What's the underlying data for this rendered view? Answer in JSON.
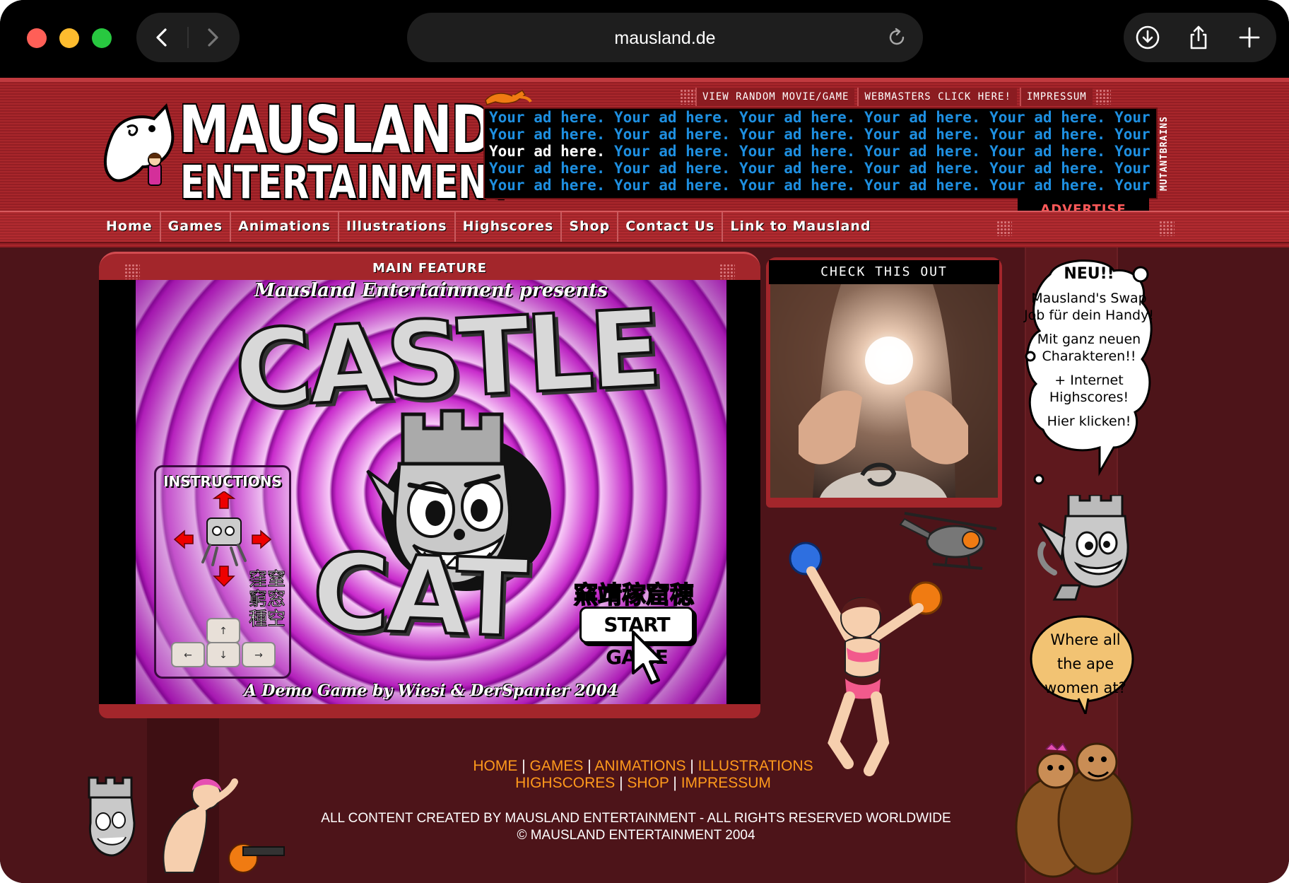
{
  "browser": {
    "url": "mausland.de"
  },
  "header": {
    "logo_line1": "MAUSLAND",
    "logo_line2": "ENTERTAINMENT",
    "top_links": [
      "VIEW RANDOM MOVIE/GAME",
      "WEBMASTERS CLICK HERE!",
      "IMPRESSUM"
    ],
    "ad_text": "Your ad here.",
    "advertise": "ADVERTISE HERE",
    "sidebar_vertical": "MUTANTBRAINS"
  },
  "nav": {
    "items": [
      "Home",
      "Games",
      "Animations",
      "Illustrations",
      "Highscores",
      "Shop",
      "Contact Us",
      "Link to Mausland"
    ]
  },
  "feature": {
    "title": "MAIN FEATURE",
    "presents": "Mausland Entertainment presents",
    "game_title_1": "CASTLE",
    "game_title_2": "CAT",
    "instructions_title": "INSTRUCTIONS",
    "kanji_line": "窯靖稼窟穂",
    "kanji_block": "窪窒窮窓種空",
    "start_button": "START GAME",
    "credit": "A Demo Game by Wiesi & DerSpanier 2004"
  },
  "check": {
    "title": "CHECK THIS OUT"
  },
  "bubble": {
    "line1": "NEU!!",
    "line2": "Mausland's Swap Job für dein Handy!",
    "line3": "Mit ganz neuen Charakteren!!",
    "line4": "+ Internet Highscores!",
    "line5": "Hier klicken!"
  },
  "bubble2": {
    "text": "Where all the ape women at?"
  },
  "footer": {
    "row1": [
      "HOME",
      "GAMES",
      "ANIMATIONS",
      "ILLUSTRATIONS"
    ],
    "row2": [
      "HIGHSCORES",
      "SHOP",
      "IMPRESSUM"
    ],
    "separator": "|",
    "rights": "ALL CONTENT CREATED BY MAUSLAND ENTERTAINMENT - ALL RIGHTS RESERVED WORLDWIDE",
    "copyright": "© MAUSLAND ENTERTAINMENT 2004"
  },
  "colors": {
    "page_bg": "#4d1419",
    "header_red": "#a8262b",
    "ad_blue": "#1e8fe0",
    "footer_link": "#ff9a1c"
  }
}
